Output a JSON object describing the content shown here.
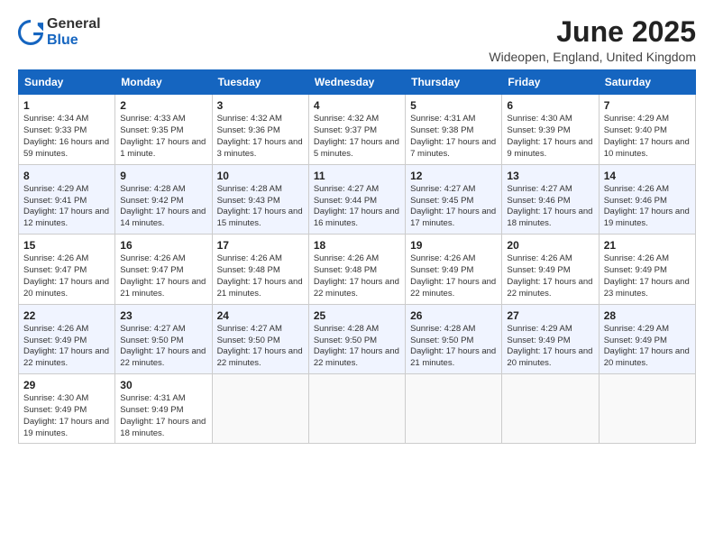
{
  "logo": {
    "text_general": "General",
    "text_blue": "Blue"
  },
  "header": {
    "month": "June 2025",
    "location": "Wideopen, England, United Kingdom"
  },
  "weekdays": [
    "Sunday",
    "Monday",
    "Tuesday",
    "Wednesday",
    "Thursday",
    "Friday",
    "Saturday"
  ],
  "weeks": [
    [
      {
        "day": "1",
        "sunrise": "Sunrise: 4:34 AM",
        "sunset": "Sunset: 9:33 PM",
        "daylight": "Daylight: 16 hours and 59 minutes."
      },
      {
        "day": "2",
        "sunrise": "Sunrise: 4:33 AM",
        "sunset": "Sunset: 9:35 PM",
        "daylight": "Daylight: 17 hours and 1 minute."
      },
      {
        "day": "3",
        "sunrise": "Sunrise: 4:32 AM",
        "sunset": "Sunset: 9:36 PM",
        "daylight": "Daylight: 17 hours and 3 minutes."
      },
      {
        "day": "4",
        "sunrise": "Sunrise: 4:32 AM",
        "sunset": "Sunset: 9:37 PM",
        "daylight": "Daylight: 17 hours and 5 minutes."
      },
      {
        "day": "5",
        "sunrise": "Sunrise: 4:31 AM",
        "sunset": "Sunset: 9:38 PM",
        "daylight": "Daylight: 17 hours and 7 minutes."
      },
      {
        "day": "6",
        "sunrise": "Sunrise: 4:30 AM",
        "sunset": "Sunset: 9:39 PM",
        "daylight": "Daylight: 17 hours and 9 minutes."
      },
      {
        "day": "7",
        "sunrise": "Sunrise: 4:29 AM",
        "sunset": "Sunset: 9:40 PM",
        "daylight": "Daylight: 17 hours and 10 minutes."
      }
    ],
    [
      {
        "day": "8",
        "sunrise": "Sunrise: 4:29 AM",
        "sunset": "Sunset: 9:41 PM",
        "daylight": "Daylight: 17 hours and 12 minutes."
      },
      {
        "day": "9",
        "sunrise": "Sunrise: 4:28 AM",
        "sunset": "Sunset: 9:42 PM",
        "daylight": "Daylight: 17 hours and 14 minutes."
      },
      {
        "day": "10",
        "sunrise": "Sunrise: 4:28 AM",
        "sunset": "Sunset: 9:43 PM",
        "daylight": "Daylight: 17 hours and 15 minutes."
      },
      {
        "day": "11",
        "sunrise": "Sunrise: 4:27 AM",
        "sunset": "Sunset: 9:44 PM",
        "daylight": "Daylight: 17 hours and 16 minutes."
      },
      {
        "day": "12",
        "sunrise": "Sunrise: 4:27 AM",
        "sunset": "Sunset: 9:45 PM",
        "daylight": "Daylight: 17 hours and 17 minutes."
      },
      {
        "day": "13",
        "sunrise": "Sunrise: 4:27 AM",
        "sunset": "Sunset: 9:46 PM",
        "daylight": "Daylight: 17 hours and 18 minutes."
      },
      {
        "day": "14",
        "sunrise": "Sunrise: 4:26 AM",
        "sunset": "Sunset: 9:46 PM",
        "daylight": "Daylight: 17 hours and 19 minutes."
      }
    ],
    [
      {
        "day": "15",
        "sunrise": "Sunrise: 4:26 AM",
        "sunset": "Sunset: 9:47 PM",
        "daylight": "Daylight: 17 hours and 20 minutes."
      },
      {
        "day": "16",
        "sunrise": "Sunrise: 4:26 AM",
        "sunset": "Sunset: 9:47 PM",
        "daylight": "Daylight: 17 hours and 21 minutes."
      },
      {
        "day": "17",
        "sunrise": "Sunrise: 4:26 AM",
        "sunset": "Sunset: 9:48 PM",
        "daylight": "Daylight: 17 hours and 21 minutes."
      },
      {
        "day": "18",
        "sunrise": "Sunrise: 4:26 AM",
        "sunset": "Sunset: 9:48 PM",
        "daylight": "Daylight: 17 hours and 22 minutes."
      },
      {
        "day": "19",
        "sunrise": "Sunrise: 4:26 AM",
        "sunset": "Sunset: 9:49 PM",
        "daylight": "Daylight: 17 hours and 22 minutes."
      },
      {
        "day": "20",
        "sunrise": "Sunrise: 4:26 AM",
        "sunset": "Sunset: 9:49 PM",
        "daylight": "Daylight: 17 hours and 22 minutes."
      },
      {
        "day": "21",
        "sunrise": "Sunrise: 4:26 AM",
        "sunset": "Sunset: 9:49 PM",
        "daylight": "Daylight: 17 hours and 23 minutes."
      }
    ],
    [
      {
        "day": "22",
        "sunrise": "Sunrise: 4:26 AM",
        "sunset": "Sunset: 9:49 PM",
        "daylight": "Daylight: 17 hours and 22 minutes."
      },
      {
        "day": "23",
        "sunrise": "Sunrise: 4:27 AM",
        "sunset": "Sunset: 9:50 PM",
        "daylight": "Daylight: 17 hours and 22 minutes."
      },
      {
        "day": "24",
        "sunrise": "Sunrise: 4:27 AM",
        "sunset": "Sunset: 9:50 PM",
        "daylight": "Daylight: 17 hours and 22 minutes."
      },
      {
        "day": "25",
        "sunrise": "Sunrise: 4:28 AM",
        "sunset": "Sunset: 9:50 PM",
        "daylight": "Daylight: 17 hours and 22 minutes."
      },
      {
        "day": "26",
        "sunrise": "Sunrise: 4:28 AM",
        "sunset": "Sunset: 9:50 PM",
        "daylight": "Daylight: 17 hours and 21 minutes."
      },
      {
        "day": "27",
        "sunrise": "Sunrise: 4:29 AM",
        "sunset": "Sunset: 9:49 PM",
        "daylight": "Daylight: 17 hours and 20 minutes."
      },
      {
        "day": "28",
        "sunrise": "Sunrise: 4:29 AM",
        "sunset": "Sunset: 9:49 PM",
        "daylight": "Daylight: 17 hours and 20 minutes."
      }
    ],
    [
      {
        "day": "29",
        "sunrise": "Sunrise: 4:30 AM",
        "sunset": "Sunset: 9:49 PM",
        "daylight": "Daylight: 17 hours and 19 minutes."
      },
      {
        "day": "30",
        "sunrise": "Sunrise: 4:31 AM",
        "sunset": "Sunset: 9:49 PM",
        "daylight": "Daylight: 17 hours and 18 minutes."
      },
      null,
      null,
      null,
      null,
      null
    ]
  ]
}
